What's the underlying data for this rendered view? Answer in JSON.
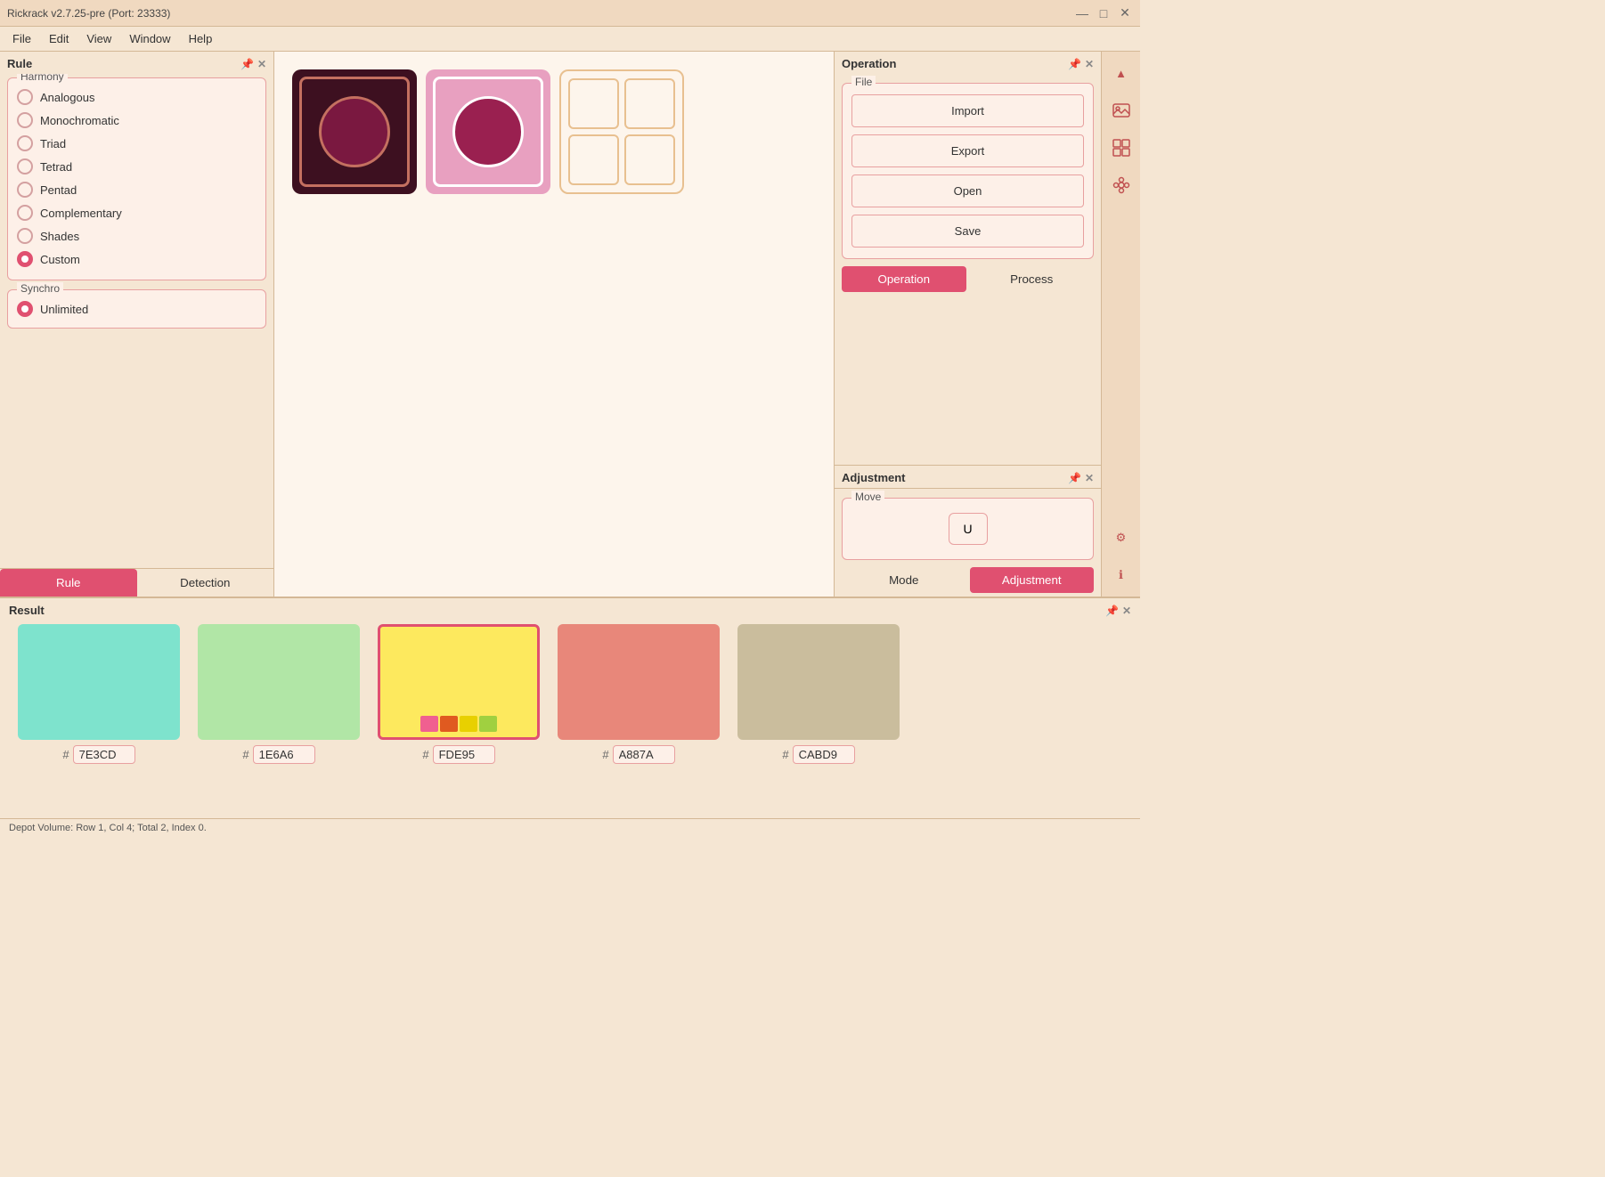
{
  "titlebar": {
    "title": "Rickrack v2.7.25-pre (Port: 23333)",
    "minimize": "—",
    "maximize": "□",
    "close": "✕"
  },
  "menubar": {
    "items": [
      "File",
      "Edit",
      "View",
      "Window",
      "Help"
    ]
  },
  "left_panel": {
    "title": "Rule",
    "harmony_group": {
      "label": "Harmony",
      "options": [
        {
          "id": "analogous",
          "label": "Analogous",
          "selected": false
        },
        {
          "id": "monochromatic",
          "label": "Monochromatic",
          "selected": false
        },
        {
          "id": "triad",
          "label": "Triad",
          "selected": false
        },
        {
          "id": "tetrad",
          "label": "Tetrad",
          "selected": false
        },
        {
          "id": "pentad",
          "label": "Pentad",
          "selected": false
        },
        {
          "id": "complementary",
          "label": "Complementary",
          "selected": false
        },
        {
          "id": "shades",
          "label": "Shades",
          "selected": false
        },
        {
          "id": "custom",
          "label": "Custom",
          "selected": true
        }
      ]
    },
    "synchro_group": {
      "label": "Synchro",
      "options": [
        {
          "id": "unlimited",
          "label": "Unlimited",
          "selected": true
        }
      ]
    },
    "tabs": [
      {
        "id": "rule",
        "label": "Rule",
        "active": true
      },
      {
        "id": "detection",
        "label": "Detection",
        "active": false
      }
    ]
  },
  "operation_panel": {
    "title": "Operation",
    "file_group": {
      "label": "File",
      "buttons": [
        "Import",
        "Export",
        "Open",
        "Save"
      ]
    },
    "tabs": [
      {
        "id": "operation",
        "label": "Operation",
        "active": true
      },
      {
        "id": "process",
        "label": "Process",
        "active": false
      }
    ]
  },
  "adjustment_panel": {
    "title": "Adjustment",
    "move_group": {
      "label": "Move",
      "key": "U"
    },
    "tabs": [
      {
        "id": "mode",
        "label": "Mode",
        "active": false
      },
      {
        "id": "adjustment",
        "label": "Adjustment",
        "active": true
      }
    ]
  },
  "result_panel": {
    "title": "Result",
    "swatches": [
      {
        "color": "#7ee3cd",
        "hex": "7E3CD",
        "selected": false
      },
      {
        "color": "#b1e6a6",
        "hex": "1E6A6",
        "selected": false
      },
      {
        "color": "#fde95e",
        "hex": "FDE95",
        "selected": true,
        "mini": [
          "#f06090",
          "#e05a20",
          "#e8d000",
          "#a0d040"
        ]
      },
      {
        "color": "#e8877a",
        "hex": "A887A",
        "selected": false
      },
      {
        "color": "#cabd9d",
        "hex": "CABD9",
        "selected": false
      }
    ]
  },
  "status_bar": {
    "text": "Depot Volume: Row 1, Col 4; Total 2, Index 0."
  },
  "icons": {
    "triangle": "▲",
    "image": "🖼",
    "grid": "⊞",
    "flower": "✿",
    "gear": "⚙",
    "info": "ℹ"
  }
}
